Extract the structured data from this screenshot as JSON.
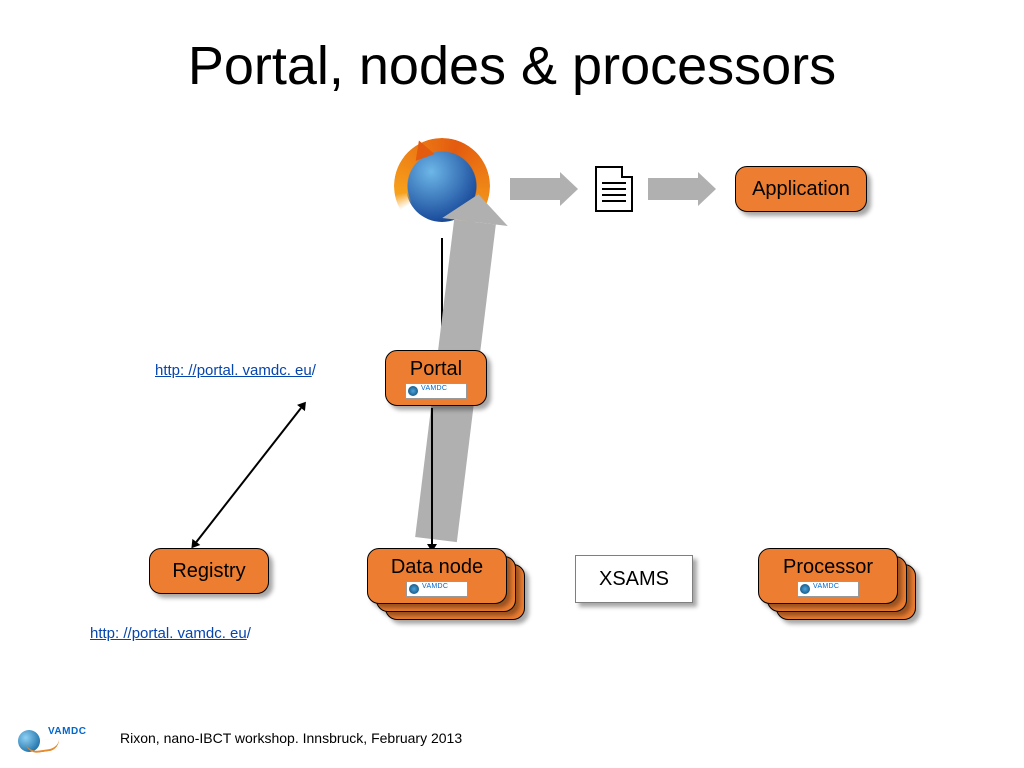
{
  "title": "Portal, nodes & processors",
  "nodes": {
    "application": "Application",
    "portal": "Portal",
    "registry": "Registry",
    "datanode": "Data node",
    "processor": "Processor"
  },
  "labels": {
    "xsams": "XSAMS"
  },
  "links": {
    "portal_url_visible": "http: //portal. vamdc. eu",
    "registry_url_visible": "http: //portal. vamdc. eu",
    "url_trailing_slash": "/"
  },
  "icons": {
    "browser": "firefox-icon",
    "document": "document-icon",
    "vamdc_logo_small": "vamdc-mini-logo",
    "vamdc_logo_footer": "vamdc-footer-logo"
  },
  "footer": "Rixon, nano-IBCT workshop. Innsbruck, February 2013"
}
